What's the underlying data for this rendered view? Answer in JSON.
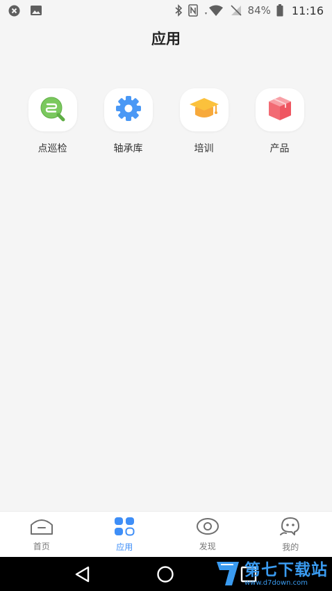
{
  "status_bar": {
    "battery": "84%",
    "time": "11:16"
  },
  "title": "应用",
  "apps": [
    {
      "label": "点巡检",
      "icon": "inspection-search-icon",
      "color": "#6dbf52"
    },
    {
      "label": "轴承库",
      "icon": "gear-icon",
      "color": "#3e8ef7"
    },
    {
      "label": "培训",
      "icon": "graduation-cap-icon",
      "color": "#f5a623"
    },
    {
      "label": "产品",
      "icon": "cube-icon",
      "color": "#f0616d"
    }
  ],
  "tabs": [
    {
      "label": "首页",
      "icon": "home-icon",
      "active": false
    },
    {
      "label": "应用",
      "icon": "apps-grid-icon",
      "active": true
    },
    {
      "label": "发现",
      "icon": "eye-icon",
      "active": false
    },
    {
      "label": "我的",
      "icon": "profile-face-icon",
      "active": false
    }
  ],
  "watermark": {
    "title": "第七下载站",
    "url": "www.d7down.com"
  },
  "colors": {
    "accent": "#3e8ef7",
    "background": "#f5f5f5"
  }
}
